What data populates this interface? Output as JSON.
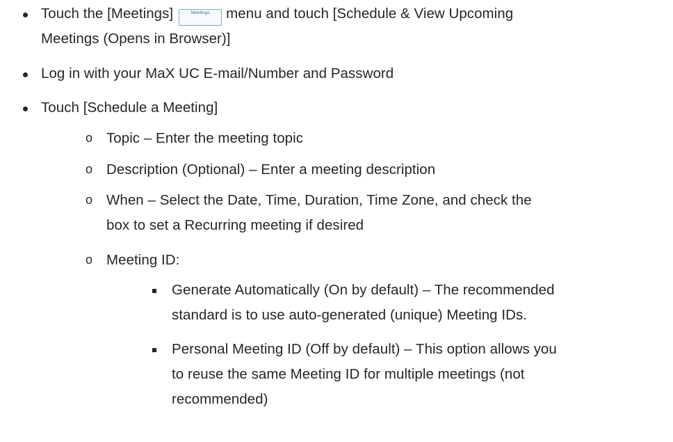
{
  "steps": [
    {
      "pre": "Touch the [Meetings]",
      "chip_label": "Meetings",
      "post": "menu and touch [Schedule & View Upcoming",
      "line2": "Meetings (Opens in Browser)]"
    },
    {
      "text": "Log in with your MaX UC E-mail/Number and Password"
    },
    {
      "text": "Touch [Schedule a Meeting]",
      "substeps": [
        {
          "text": "Topic – Enter the meeting topic"
        },
        {
          "text": "Description (Optional) – Enter a meeting description"
        },
        {
          "line1": "When – Select the Date, Time, Duration, Time Zone, and check the",
          "line2": "box to set a Recurring meeting if desired"
        },
        {
          "text": "Meeting ID:",
          "options": [
            {
              "line1": "Generate Automatically (On by default) – The recommended",
              "line2": "standard is to use auto-generated (unique) Meeting IDs."
            },
            {
              "line1": "Personal Meeting ID (Off by default) – This option allows you",
              "line2": "to reuse the same Meeting ID for multiple meetings (not",
              "line3": "recommended)"
            }
          ]
        }
      ]
    }
  ]
}
